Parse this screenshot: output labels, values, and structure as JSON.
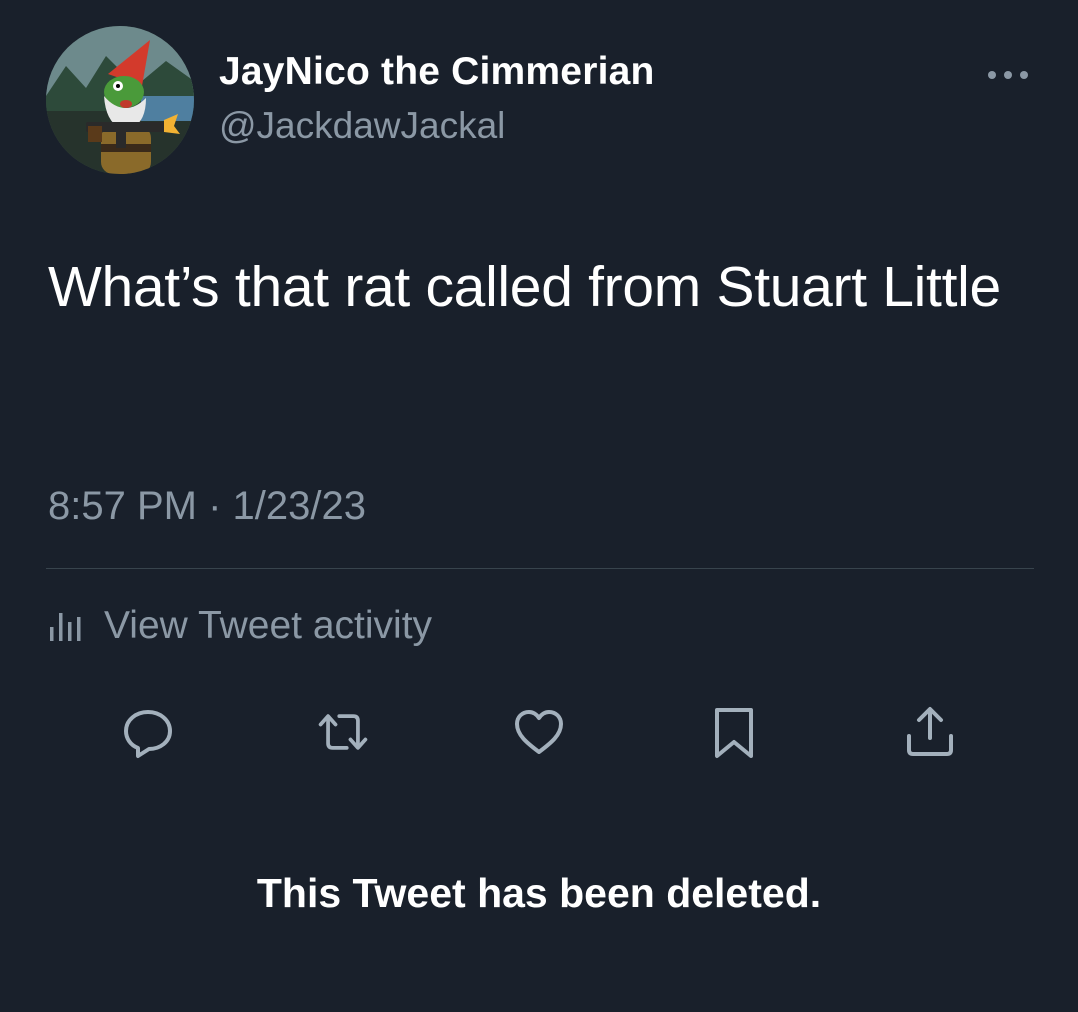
{
  "author": {
    "display_name": "JayNico the Cimmerian",
    "handle": "@JackdawJackal",
    "avatar_icon": "gnome-avatar"
  },
  "more_icon": "more-horizontal-icon",
  "tweet": {
    "text": "What’s that rat called from Stuart Little",
    "timestamp": "8:57 PM · 1/23/23"
  },
  "activity": {
    "icon": "bar-chart-icon",
    "label": "View Tweet activity"
  },
  "actions": [
    {
      "name": "reply",
      "icon": "reply-icon"
    },
    {
      "name": "retweet",
      "icon": "retweet-icon"
    },
    {
      "name": "like",
      "icon": "heart-icon"
    },
    {
      "name": "bookmark",
      "icon": "bookmark-icon"
    },
    {
      "name": "share",
      "icon": "share-icon"
    }
  ],
  "status_message": "This Tweet has been deleted.",
  "colors": {
    "background": "#19202b",
    "primary_text": "#ffffff",
    "secondary_text": "#8b98a5",
    "divider": "#38444d",
    "icon": "#a3b0bc"
  }
}
